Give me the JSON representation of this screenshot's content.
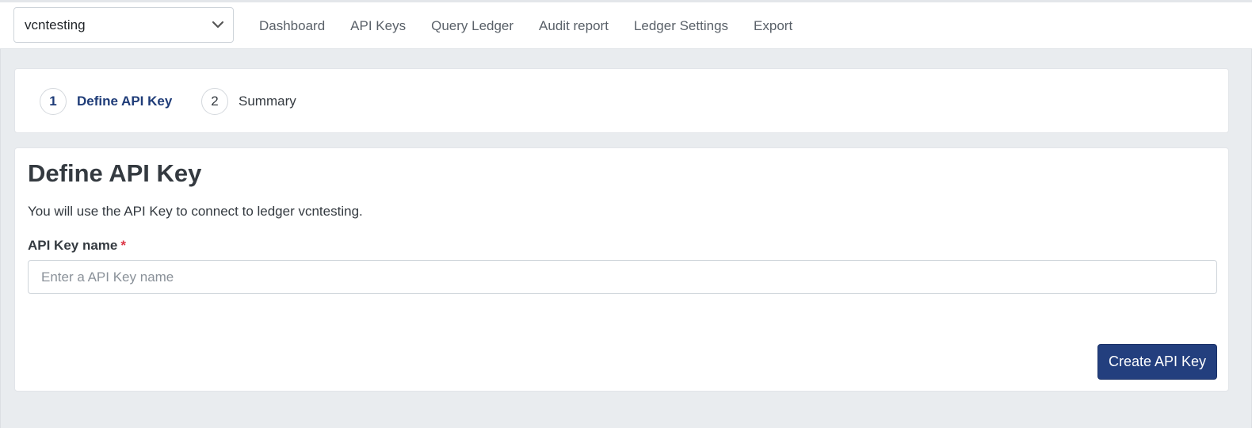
{
  "header": {
    "ledger_selector": {
      "value": "vcntesting",
      "icon": "chevron-down-icon"
    },
    "nav": [
      {
        "label": "Dashboard"
      },
      {
        "label": "API Keys"
      },
      {
        "label": "Query Ledger"
      },
      {
        "label": "Audit report"
      },
      {
        "label": "Ledger Settings"
      },
      {
        "label": "Export"
      }
    ]
  },
  "steps": [
    {
      "number": "1",
      "label": "Define API Key",
      "state": "active"
    },
    {
      "number": "2",
      "label": "Summary",
      "state": "inactive"
    }
  ],
  "form": {
    "title": "Define API Key",
    "description": "You will use the API Key to connect to ledger vcntesting.",
    "field_label": "API Key name",
    "required_marker": "*",
    "input_value": "",
    "input_placeholder": "Enter a API Key name",
    "submit_label": "Create API Key"
  },
  "colors": {
    "primary": "#233f7e",
    "active_step": "#1f3c78",
    "required": "#dc3545",
    "background": "#e9ecef"
  }
}
